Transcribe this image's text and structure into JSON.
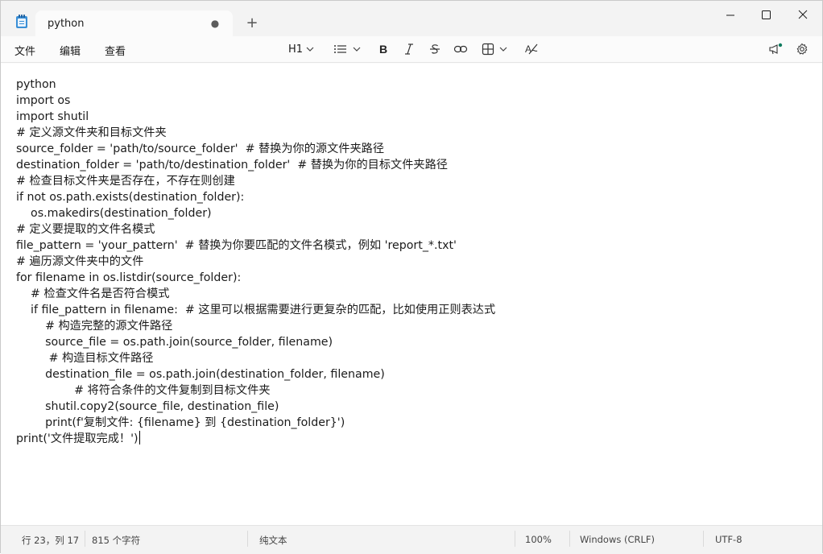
{
  "tab": {
    "title": "python"
  },
  "window_controls": {
    "minimize": "—",
    "maximize": "☐",
    "close": "✕"
  },
  "menu": [
    "文件",
    "编辑",
    "查看"
  ],
  "toolbar": {
    "heading": "H1",
    "icons": [
      "list-icon",
      "bold-icon",
      "italic-icon",
      "strikethrough-icon",
      "link-icon",
      "table-icon",
      "clear-formatting-icon",
      "feedback-icon",
      "settings-icon"
    ]
  },
  "editor": {
    "lines": [
      "python",
      "import os",
      "import shutil",
      "# 定义源文件夹和目标文件夹",
      "source_folder = 'path/to/source_folder'  # 替换为你的源文件夹路径",
      "destination_folder = 'path/to/destination_folder'  # 替换为你的目标文件夹路径",
      "# 检查目标文件夹是否存在，不存在则创建",
      "if not os.path.exists(destination_folder):",
      "    os.makedirs(destination_folder)",
      "# 定义要提取的文件名模式",
      "file_pattern = 'your_pattern'  # 替换为你要匹配的文件名模式，例如 'report_*.txt'",
      "# 遍历源文件夹中的文件",
      "for filename in os.listdir(source_folder):",
      "    # 检查文件名是否符合模式",
      "    if file_pattern in filename:  # 这里可以根据需要进行更复杂的匹配，比如使用正则表达式",
      "        # 构造完整的源文件路径",
      "        source_file = os.path.join(source_folder, filename)",
      "         # 构造目标文件路径",
      "        destination_file = os.path.join(destination_folder, filename)",
      "                # 将符合条件的文件复制到目标文件夹",
      "        shutil.copy2(source_file, destination_file)",
      "        print(f'复制文件: {filename} 到 {destination_folder}')",
      "print('文件提取完成！')"
    ]
  },
  "status": {
    "position": "行 23，列 17",
    "char_count": "815 个字符",
    "format": "纯文本",
    "zoom": "100%",
    "line_ending": "Windows (CRLF)",
    "encoding": "UTF-8"
  }
}
